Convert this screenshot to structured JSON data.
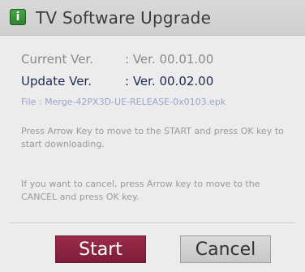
{
  "dialog": {
    "title": "TV Software Upgrade",
    "icon": "info-icon",
    "current": {
      "label": "Current Ver.",
      "value": ": Ver. 00.01.00"
    },
    "update": {
      "label": "Update Ver.",
      "value": ": Ver. 00.02.00"
    },
    "file": "File : Merge-42PX3D-UE-RELEASE-0x0103.epk",
    "message1": "Press Arrow Key to move to the START and press OK key to start downloading.",
    "message2": "If you want to cancel, press Arrow key to move to the CANCEL and press OK key.",
    "buttons": {
      "start": "Start",
      "cancel": "Cancel"
    },
    "colors": {
      "start_button": "#8a2342",
      "cancel_button": "#cfcfcf",
      "icon_green": "#3b8f3b"
    }
  }
}
